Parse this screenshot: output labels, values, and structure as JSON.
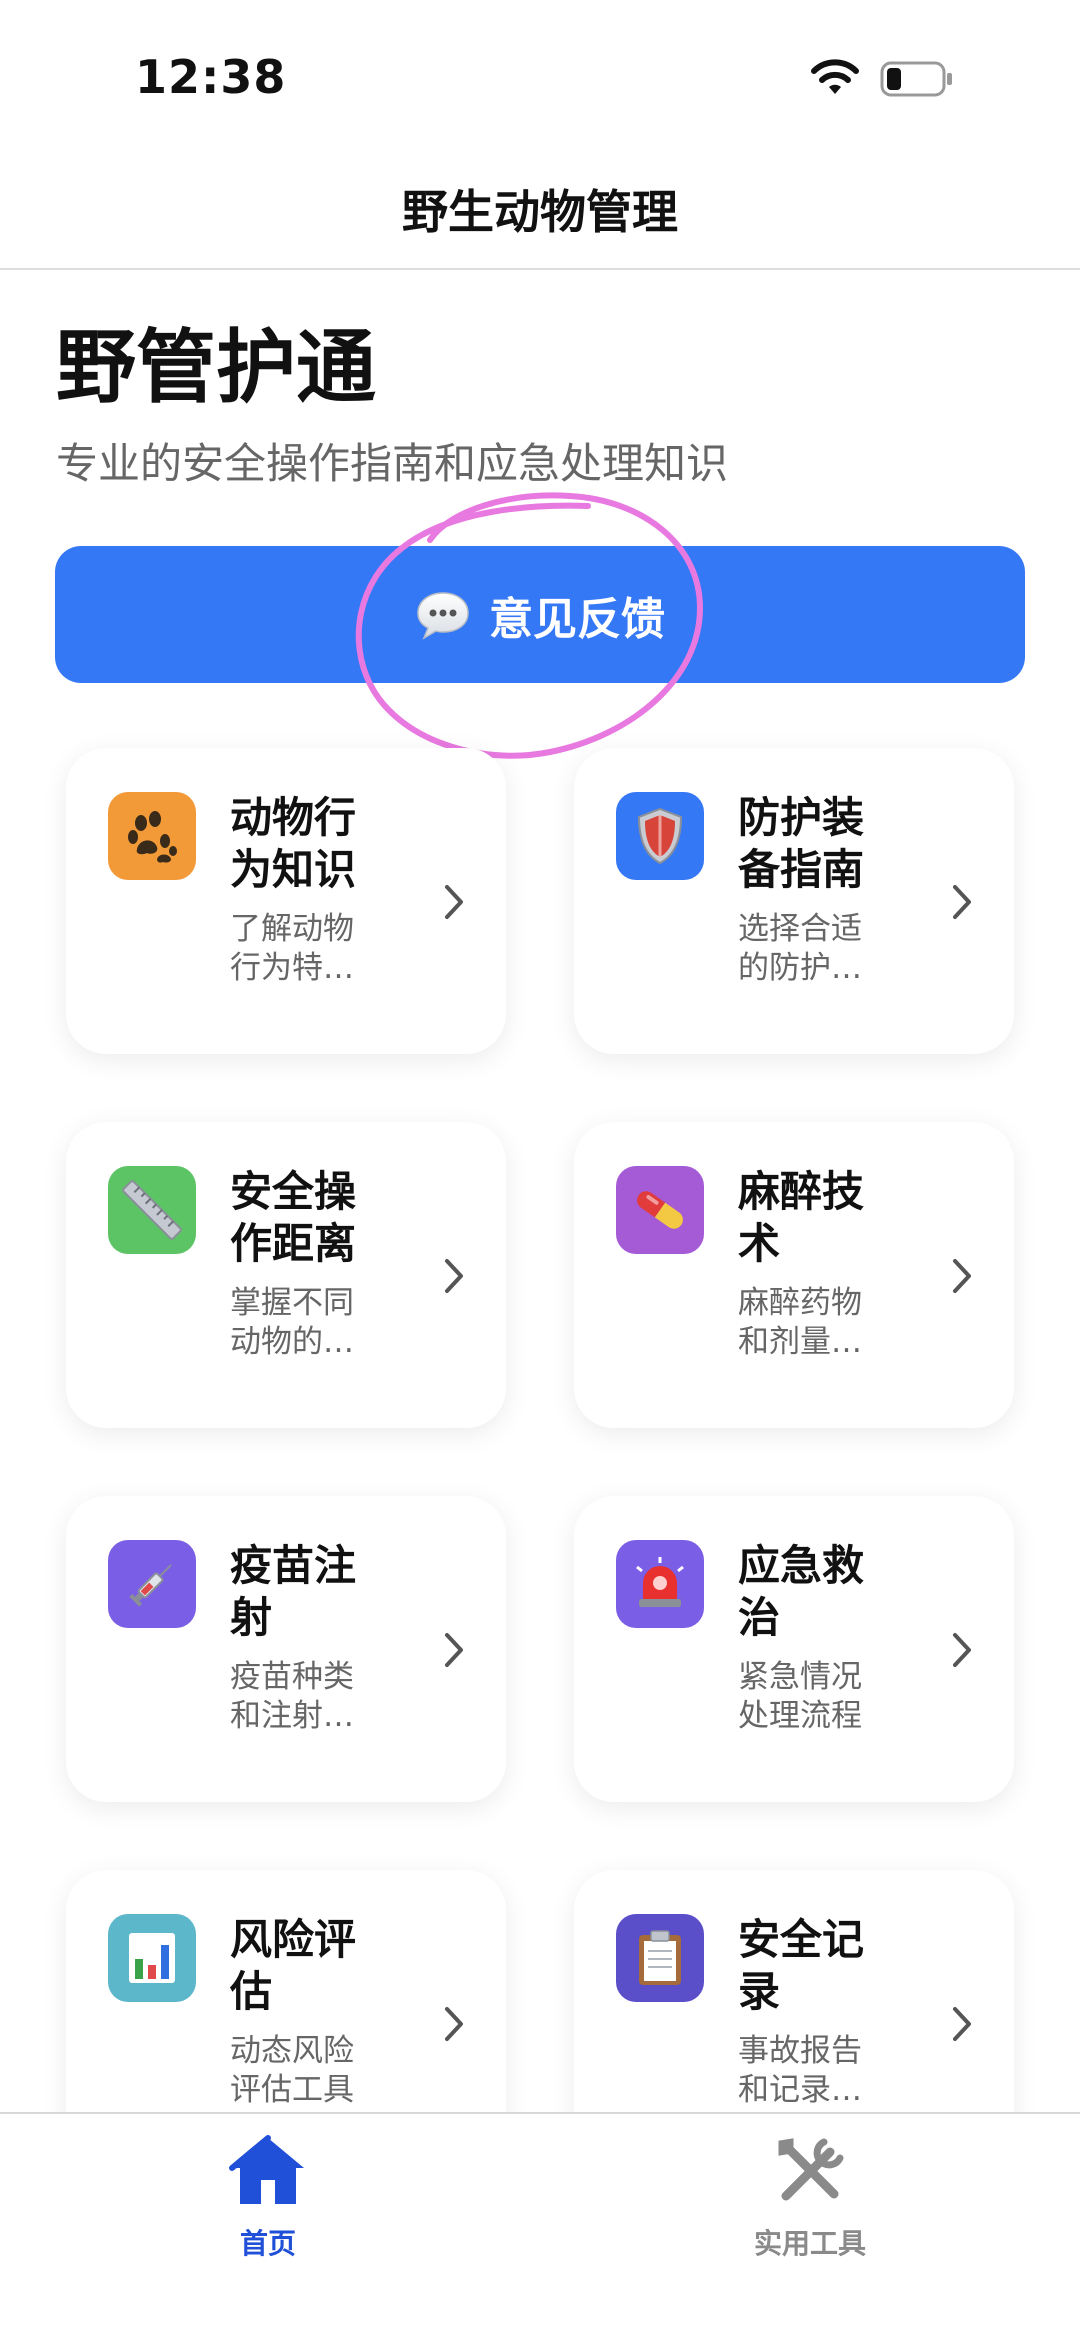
{
  "status_bar": {
    "time": "12:38"
  },
  "nav": {
    "title": "野生动物管理"
  },
  "header": {
    "title": "野管护通",
    "subtitle": "专业的安全操作指南和应急处理知识"
  },
  "feedback": {
    "label": "意见反馈"
  },
  "cards": [
    {
      "title": "动物行为知识",
      "desc": "了解动物行为特…",
      "icon": "paw-icon",
      "color": "#f29a38"
    },
    {
      "title": "防护装备指南",
      "desc": "选择合适的防护…",
      "icon": "shield-icon",
      "color": "#3478f6"
    },
    {
      "title": "安全操作距离",
      "desc": "掌握不同动物的…",
      "icon": "ruler-icon",
      "color": "#5cc465"
    },
    {
      "title": "麻醉技术",
      "desc": "麻醉药物和剂量…",
      "icon": "pill-icon",
      "color": "#a55ad6"
    },
    {
      "title": "疫苗注射",
      "desc": "疫苗种类和注射…",
      "icon": "syringe-icon",
      "color": "#7b5ee6"
    },
    {
      "title": "应急救治",
      "desc": "紧急情况处理流程",
      "icon": "siren-icon",
      "color": "#7b5ee6"
    },
    {
      "title": "风险评估",
      "desc": "动态风险评估工具",
      "icon": "bar-chart-icon",
      "color": "#5bb7c9"
    },
    {
      "title": "安全记录",
      "desc": "事故报告和记录…",
      "icon": "clipboard-icon",
      "color": "#5a4fc8"
    }
  ],
  "tabs": [
    {
      "label": "首页",
      "icon": "home-icon",
      "color": "#2150d8",
      "active": true
    },
    {
      "label": "实用工具",
      "icon": "tools-icon",
      "color": "#8a8a8a",
      "active": false
    }
  ],
  "colors": {
    "accent": "#3478f6",
    "annotation": "#e879e0"
  }
}
